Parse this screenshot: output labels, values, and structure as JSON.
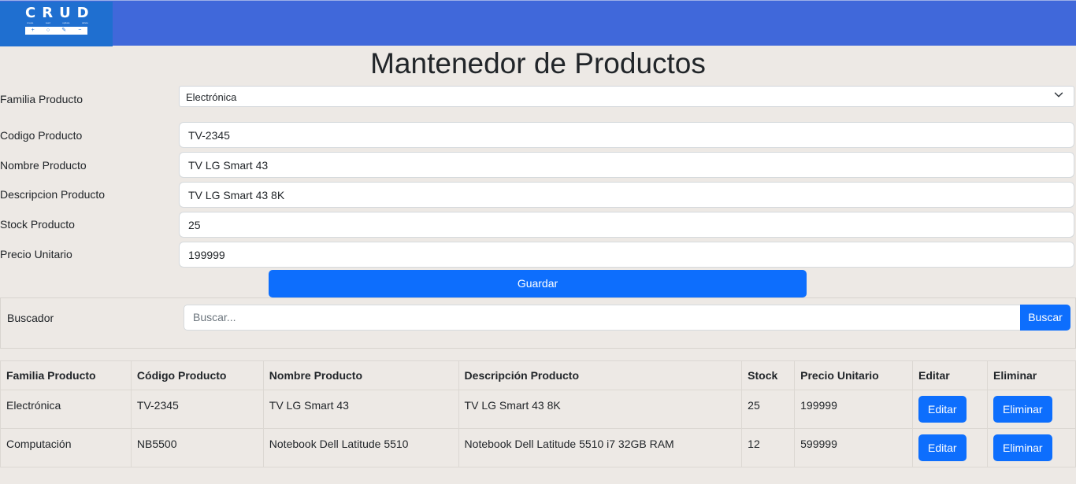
{
  "brand": {
    "logo_text": "CRUD",
    "logo_subtitle": [
      "create",
      "read",
      "update",
      "delete"
    ],
    "logo_icons": [
      "+",
      "○",
      "✎",
      "−"
    ],
    "color_navbar": "#4068da",
    "color_primary": "#0d6efd"
  },
  "page": {
    "title": "Mantenedor de Productos"
  },
  "form": {
    "familia": {
      "label": "Familia Producto",
      "value": "Electrónica"
    },
    "codigo": {
      "label": "Codigo Producto",
      "value": "TV-2345"
    },
    "nombre": {
      "label": "Nombre Producto",
      "value": "TV LG Smart 43"
    },
    "descripcion": {
      "label": "Descripcion Producto",
      "value": "TV LG Smart 43 8K"
    },
    "stock": {
      "label": "Stock Producto",
      "value": "25"
    },
    "precio": {
      "label": "Precio Unitario",
      "value": "199999"
    },
    "save_label": "Guardar"
  },
  "search": {
    "label": "Buscador",
    "placeholder": "Buscar...",
    "button": "Buscar"
  },
  "table": {
    "headers": [
      "Familia Producto",
      "Código Producto",
      "Nombre Producto",
      "Descripción Producto",
      "Stock",
      "Precio Unitario",
      "Editar",
      "Eliminar"
    ],
    "rows": [
      {
        "familia": "Electrónica",
        "codigo": "TV-2345",
        "nombre": "TV LG Smart 43",
        "descripcion": "TV LG Smart 43 8K",
        "stock": "25",
        "precio": "199999",
        "edit": "Editar",
        "delete": "Eliminar"
      },
      {
        "familia": "Computación",
        "codigo": "NB5500",
        "nombre": "Notebook Dell Latitude 5510",
        "descripcion": "Notebook Dell Latitude 5510 i7 32GB RAM",
        "stock": "12",
        "precio": "599999",
        "edit": "Editar",
        "delete": "Eliminar"
      }
    ]
  }
}
